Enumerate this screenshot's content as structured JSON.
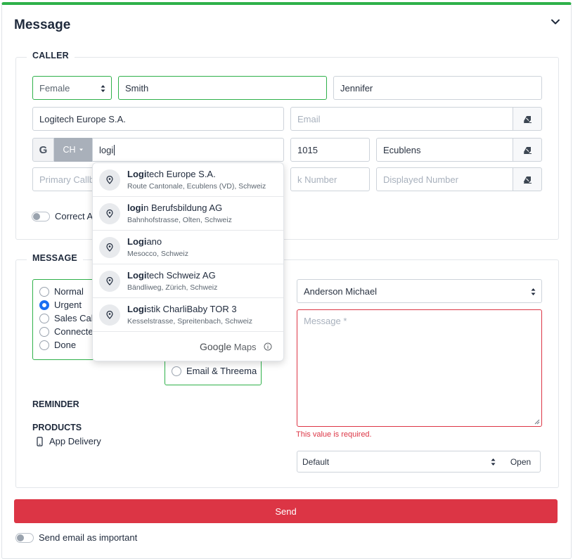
{
  "header": {
    "title": "Message"
  },
  "caller": {
    "legend": "CALLER",
    "salutation": "Female",
    "last_name": "Smith",
    "first_name": "Jennifer",
    "company": "Logitech Europe S.A.",
    "email_placeholder": "Email",
    "google_label": "G",
    "country": "CH",
    "address_value": "logi",
    "zip": "1015",
    "city": "Ecublens",
    "primary_callback_placeholder": "Primary Callb",
    "callback_number_placeholder": "k Number",
    "displayed_number_placeholder": "Displayed Number",
    "correct_toggle_label": "Correct A"
  },
  "autocomplete": {
    "items": [
      {
        "match": "Logi",
        "rest": "tech Europe S.A.",
        "address": "Route Cantonale, Ecublens (VD), Schweiz"
      },
      {
        "match": "logi",
        "rest": "n Berufsbildung AG",
        "address": "Bahnhofstrasse, Olten, Schweiz"
      },
      {
        "match": "Logi",
        "rest": "ano",
        "address": "Mesocco, Schweiz"
      },
      {
        "match": "Logi",
        "rest": "tech Schweiz AG",
        "address": "Bändliweg, Zürich, Schweiz"
      },
      {
        "match": "Logi",
        "rest": "stik CharliBaby TOR 3",
        "address": "Kesselstrasse, Spreitenbach, Schweiz"
      }
    ],
    "footer_brand_1": "Google",
    "footer_brand_2": " Maps"
  },
  "message": {
    "legend": "MESSAGE",
    "priorities": [
      {
        "label": "Normal",
        "checked": false
      },
      {
        "label": "Urgent",
        "checked": true
      },
      {
        "label": "Sales Call",
        "checked": false
      },
      {
        "label": "Connecte",
        "checked": false
      },
      {
        "label": "Done",
        "checked": false
      }
    ],
    "channel_option": "Email & Threema",
    "recipient": "Anderson Michael",
    "message_placeholder": "Message *",
    "error": "This value is required.",
    "template": "Default",
    "open_label": "Open",
    "reminder_label": "REMINDER",
    "products_label": "PRODUCTS",
    "product_item": "App Delivery"
  },
  "footer": {
    "send_label": "Send",
    "important_toggle_label": "Send email as important"
  },
  "colors": {
    "accent_green": "#2fb14a",
    "danger": "#dc3545",
    "radio_blue": "#1a6ff2"
  }
}
